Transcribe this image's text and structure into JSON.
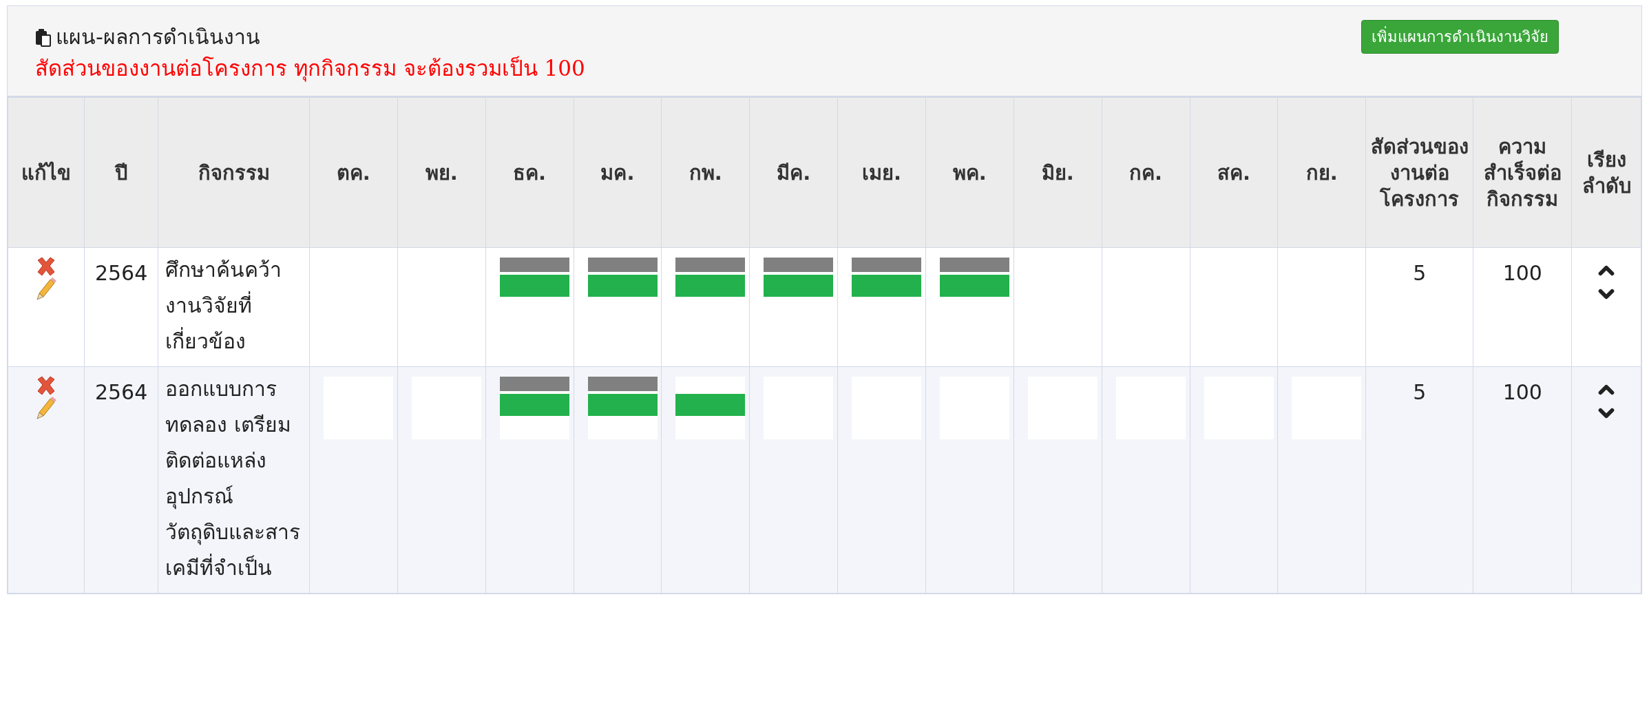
{
  "panel": {
    "title": "แผน-ผลการดำเนินงาน",
    "notice": "สัดส่วนของงานต่อโครงการ ทุกกิจกรรม จะต้องรวมเป็น 100",
    "add_button": "เพิ่มแผนการดำเนินงานวิจัย"
  },
  "table": {
    "columns": [
      "แก้ไข",
      "ปี",
      "กิจกรรม",
      "ตค.",
      "พย.",
      "ธค.",
      "มค.",
      "กพ.",
      "มีค.",
      "เมย.",
      "พค.",
      "มิย.",
      "กค.",
      "สค.",
      "กย.",
      "สัดส่วนของงานต่อโครงการ",
      "ความสำเร็จต่อกิจกรรม",
      "เรียงลำดับ"
    ],
    "rows": [
      {
        "year": "2564",
        "activity": "ศึกษาค้นคว้างานวิจัยที่เกี่ยวข้อง",
        "share": "5",
        "success": "100",
        "months": [
          {
            "planned": false,
            "done": false
          },
          {
            "planned": false,
            "done": false
          },
          {
            "planned": true,
            "done": true
          },
          {
            "planned": true,
            "done": true
          },
          {
            "planned": true,
            "done": true
          },
          {
            "planned": true,
            "done": true
          },
          {
            "planned": true,
            "done": true
          },
          {
            "planned": true,
            "done": true
          },
          {
            "planned": false,
            "done": false
          },
          {
            "planned": false,
            "done": false
          },
          {
            "planned": false,
            "done": false
          },
          {
            "planned": false,
            "done": false
          }
        ]
      },
      {
        "year": "2564",
        "activity": "ออกแบบการทดลอง เตรียม ติดต่อแหล่งอุปกรณ์ วัตถุดิบและสารเคมีที่จำเป็น",
        "share": "5",
        "success": "100",
        "months": [
          {
            "planned": false,
            "done": false
          },
          {
            "planned": false,
            "done": false
          },
          {
            "planned": true,
            "done": true
          },
          {
            "planned": true,
            "done": true
          },
          {
            "planned": false,
            "done": true
          },
          {
            "planned": false,
            "done": false
          },
          {
            "planned": false,
            "done": false
          },
          {
            "planned": false,
            "done": false
          },
          {
            "planned": false,
            "done": false
          },
          {
            "planned": false,
            "done": false
          },
          {
            "planned": false,
            "done": false
          },
          {
            "planned": false,
            "done": false
          }
        ]
      }
    ]
  }
}
